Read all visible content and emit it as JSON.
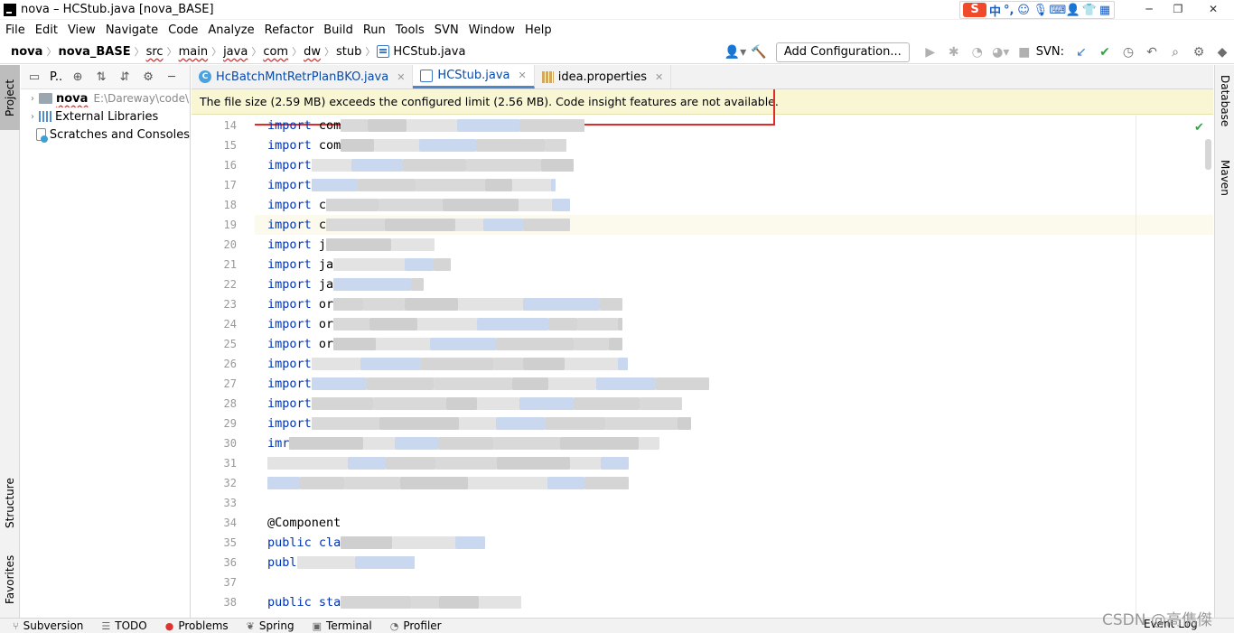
{
  "window": {
    "title": "nova – HCStub.java [nova_BASE]",
    "minimize": "─",
    "maximize": "❐",
    "close": "✕"
  },
  "ime": {
    "logo": "S",
    "mode": "中",
    "punct": "°,",
    "icons": [
      "emoji-icon",
      "mic-icon",
      "keyboard-icon",
      "user-icon",
      "shirt-icon",
      "grid-icon"
    ]
  },
  "menu": [
    "File",
    "Edit",
    "View",
    "Navigate",
    "Code",
    "Analyze",
    "Refactor",
    "Build",
    "Run",
    "Tools",
    "SVN",
    "Window",
    "Help"
  ],
  "breadcrumb": [
    "nova",
    "nova_BASE",
    "src",
    "main",
    "java",
    "com",
    "dw",
    "stub",
    "HCStub.java"
  ],
  "toolbar": {
    "add_configuration": "Add Configuration...",
    "svn_label": "SVN:"
  },
  "project_panel": {
    "title": "P..",
    "items": [
      {
        "label": "nova",
        "path": "E:\\Dareway\\code\\"
      },
      {
        "label": "External Libraries"
      },
      {
        "label": "Scratches and Consoles"
      }
    ]
  },
  "left_tools": {
    "project": "Project",
    "structure": "Structure",
    "favorites": "Favorites"
  },
  "right_tools": {
    "database": "Database",
    "maven": "Maven"
  },
  "tabs": [
    {
      "label": "HcBatchMntRetrPlanBKO.java",
      "active": false
    },
    {
      "label": "HCStub.java",
      "active": true
    },
    {
      "label": "idea.properties",
      "active": false
    }
  ],
  "warning": "The file size (2.59 MB) exceeds the configured limit (2.56 MB). Code insight features are not available.",
  "code_lines": [
    {
      "num": "14",
      "kw": "import",
      "text": " com"
    },
    {
      "num": "15",
      "kw": "import",
      "text": " com"
    },
    {
      "num": "16",
      "kw": "import",
      "text": ""
    },
    {
      "num": "17",
      "kw": "import",
      "text": ""
    },
    {
      "num": "18",
      "kw": "import",
      "text": " c"
    },
    {
      "num": "19",
      "kw": "import",
      "text": " c"
    },
    {
      "num": "20",
      "kw": "import",
      "text": " j"
    },
    {
      "num": "21",
      "kw": "import",
      "text": " ja"
    },
    {
      "num": "22",
      "kw": "import",
      "text": " ja"
    },
    {
      "num": "23",
      "kw": "import",
      "text": " or"
    },
    {
      "num": "24",
      "kw": "import",
      "text": " or"
    },
    {
      "num": "25",
      "kw": "import",
      "text": " or"
    },
    {
      "num": "26",
      "kw": "import",
      "text": ""
    },
    {
      "num": "27",
      "kw": "import",
      "text": ""
    },
    {
      "num": "28",
      "kw": "import",
      "text": ""
    },
    {
      "num": "29",
      "kw": "import",
      "text": ""
    },
    {
      "num": "30",
      "kw": "imr",
      "text": ""
    },
    {
      "num": "31",
      "kw": "",
      "text": ""
    },
    {
      "num": "32",
      "kw": "",
      "text": ""
    },
    {
      "num": "33",
      "kw": "",
      "text": ""
    },
    {
      "num": "34",
      "kw": "",
      "text": "@Component"
    },
    {
      "num": "35",
      "kw": "public cla",
      "text": ""
    },
    {
      "num": "36",
      "kw": "    publ",
      "text": ""
    },
    {
      "num": "37",
      "kw": "",
      "text": ""
    },
    {
      "num": "38",
      "kw": "    public sta",
      "text": ""
    }
  ],
  "bottom_tools": [
    "Subversion",
    "TODO",
    "Problems",
    "Spring",
    "Terminal",
    "Profiler"
  ],
  "event_log": "Event Log",
  "watermark": "CSDN @高儁傑"
}
